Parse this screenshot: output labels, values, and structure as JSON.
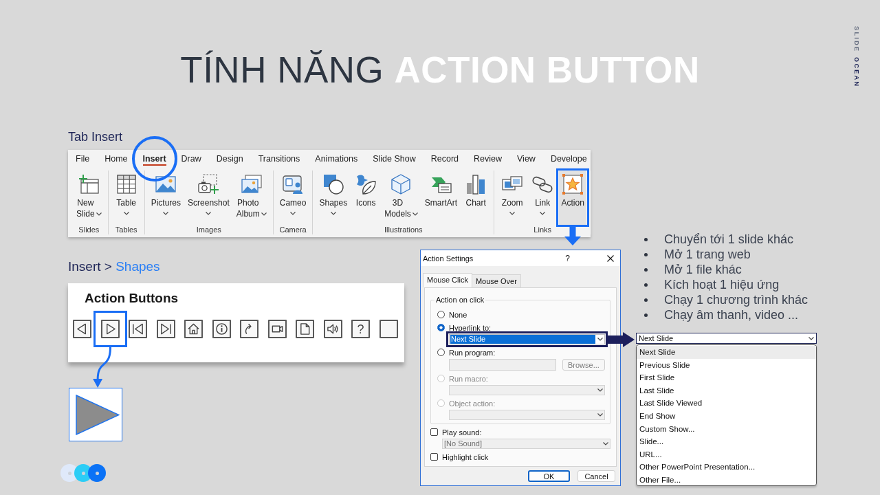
{
  "brand": [
    {
      "text": "SLIDE"
    },
    {
      "text": "OCEAN"
    }
  ],
  "title": "TÍNH NĂNG **ACTION BUTTON**",
  "ribbon": {
    "label": "Tab Insert",
    "tabs": [
      {
        "label": "File",
        "selected": false,
        "highlighted": false
      },
      {
        "label": "Home",
        "selected": false,
        "highlighted": false
      },
      {
        "label": "Insert",
        "selected": true,
        "highlighted": true
      },
      {
        "label": "Draw",
        "selected": false,
        "highlighted": false
      },
      {
        "label": "Design",
        "selected": false,
        "highlighted": false
      },
      {
        "label": "Transitions",
        "selected": false,
        "highlighted": false
      },
      {
        "label": "Animations",
        "selected": false,
        "highlighted": false
      },
      {
        "label": "Slide Show",
        "selected": false,
        "highlighted": false
      },
      {
        "label": "Record",
        "selected": false,
        "highlighted": false
      },
      {
        "label": "Review",
        "selected": false,
        "highlighted": false
      },
      {
        "label": "View",
        "selected": false,
        "highlighted": false
      },
      {
        "label": "Develope",
        "selected": false,
        "highlighted": false
      }
    ],
    "groups": [
      {
        "label": "Slides",
        "buttons": [
          {
            "label": "New Slide",
            "kind": "stacked",
            "dropdown": true,
            "highlighted": false
          }
        ]
      },
      {
        "label": "Tables",
        "buttons": [
          {
            "label": "Table",
            "kind": "single",
            "dropdown": true,
            "highlighted": false
          }
        ]
      },
      {
        "label": "Images",
        "buttons": [
          {
            "label": "Pictures",
            "kind": "single",
            "dropdown": true,
            "highlighted": false
          },
          {
            "label": "Screenshot",
            "kind": "single",
            "dropdown": true,
            "highlighted": false
          },
          {
            "label": "Photo Album",
            "kind": "stacked",
            "dropdown": true,
            "highlighted": false
          }
        ]
      },
      {
        "label": "Camera",
        "buttons": [
          {
            "label": "Cameo",
            "kind": "single",
            "dropdown": true,
            "highlighted": false
          }
        ]
      },
      {
        "label": "Illustrations",
        "buttons": [
          {
            "label": "Shapes",
            "kind": "single",
            "dropdown": true,
            "highlighted": false
          },
          {
            "label": "Icons",
            "kind": "single",
            "dropdown": false,
            "highlighted": false
          },
          {
            "label": "3D Models",
            "kind": "stacked",
            "dropdown": true,
            "highlighted": false
          },
          {
            "label": "SmartArt",
            "kind": "single",
            "dropdown": false,
            "highlighted": false
          },
          {
            "label": "Chart",
            "kind": "single",
            "dropdown": false,
            "highlighted": false
          }
        ]
      },
      {
        "label": "Links",
        "buttons": [
          {
            "label": "Zoom",
            "kind": "single",
            "dropdown": true,
            "highlighted": false
          },
          {
            "label": "Link",
            "kind": "single",
            "dropdown": true,
            "highlighted": false
          },
          {
            "label": "Action",
            "kind": "single",
            "dropdown": false,
            "highlighted": true
          }
        ]
      }
    ]
  },
  "shapes_panel": {
    "breadcrumb": {
      "text": "Insert >",
      "highlight": "Shapes"
    },
    "title": "Action Buttons",
    "buttons": [
      {
        "kind": "back",
        "highlighted": false
      },
      {
        "kind": "forward",
        "highlighted": true
      },
      {
        "kind": "beginning",
        "highlighted": false
      },
      {
        "kind": "end",
        "highlighted": false
      },
      {
        "kind": "home",
        "highlighted": false
      },
      {
        "kind": "information",
        "highlighted": false
      },
      {
        "kind": "return",
        "highlighted": false
      },
      {
        "kind": "movie",
        "highlighted": false
      },
      {
        "kind": "document",
        "highlighted": false
      },
      {
        "kind": "sound",
        "highlighted": false
      },
      {
        "kind": "help",
        "symbol": "?",
        "highlighted": false
      },
      {
        "kind": "blank",
        "highlighted": false
      }
    ],
    "inserted_shape": {
      "kind": "forward"
    }
  },
  "dialog": {
    "title": "Action Settings",
    "help": "?",
    "tabs": [
      {
        "label": "Mouse Click",
        "selected": true
      },
      {
        "label": "Mouse Over",
        "selected": false
      }
    ],
    "group": "Action on click",
    "options": [
      {
        "label": "None",
        "selected": false,
        "disabled": false
      },
      {
        "label": "Hyperlink to:",
        "selected": true,
        "disabled": false,
        "control": {
          "kind": "combo",
          "value": "Next Slide",
          "focused": true,
          "disabled": false,
          "highlighted": true
        }
      },
      {
        "label": "Run program:",
        "selected": false,
        "disabled": false,
        "control": {
          "kind": "text",
          "button": {
            "label": "Browse...",
            "disabled": true
          }
        }
      },
      {
        "label": "Run macro:",
        "selected": false,
        "disabled": true,
        "control": {
          "kind": "combo",
          "focused": false,
          "disabled": true,
          "highlighted": false
        }
      },
      {
        "label": "Object action:",
        "selected": false,
        "disabled": true,
        "control": {
          "kind": "combo",
          "focused": false,
          "disabled": true,
          "highlighted": false
        }
      }
    ],
    "checkboxes": [
      {
        "label": "Play sound:",
        "checked": false,
        "control": {
          "kind": "combo",
          "value": "[No Sound]",
          "focused": false,
          "disabled": true,
          "highlighted": false
        }
      },
      {
        "label": "Highlight click",
        "checked": false
      }
    ],
    "buttons": [
      {
        "label": "OK",
        "default": true
      },
      {
        "label": "Cancel",
        "default": false
      }
    ]
  },
  "features": [
    "Chuyển tới 1 slide khác",
    "Mở 1 trang web",
    "Mở 1 file khác",
    "Kích hoạt 1 hiệu ứng",
    "Chạy 1 chương trình khác",
    "Chạy âm thanh, video ..."
  ],
  "dropdown": {
    "value": "Next Slide",
    "options": [
      {
        "label": "Next Slide",
        "selected": true
      },
      {
        "label": "Previous Slide",
        "selected": false
      },
      {
        "label": "First Slide",
        "selected": false
      },
      {
        "label": "Last Slide",
        "selected": false
      },
      {
        "label": "Last Slide Viewed",
        "selected": false
      },
      {
        "label": "End Show",
        "selected": false
      },
      {
        "label": "Custom Show...",
        "selected": false
      },
      {
        "label": "Slide...",
        "selected": false
      },
      {
        "label": "URL...",
        "selected": false
      },
      {
        "label": "Other PowerPoint Presentation...",
        "selected": false
      },
      {
        "label": "Other File...",
        "selected": false
      }
    ]
  },
  "decor_dots": [
    {
      "color": "#dfe9fa"
    },
    {
      "color": "#2ccdf6"
    },
    {
      "color": "#0b72f6"
    }
  ]
}
